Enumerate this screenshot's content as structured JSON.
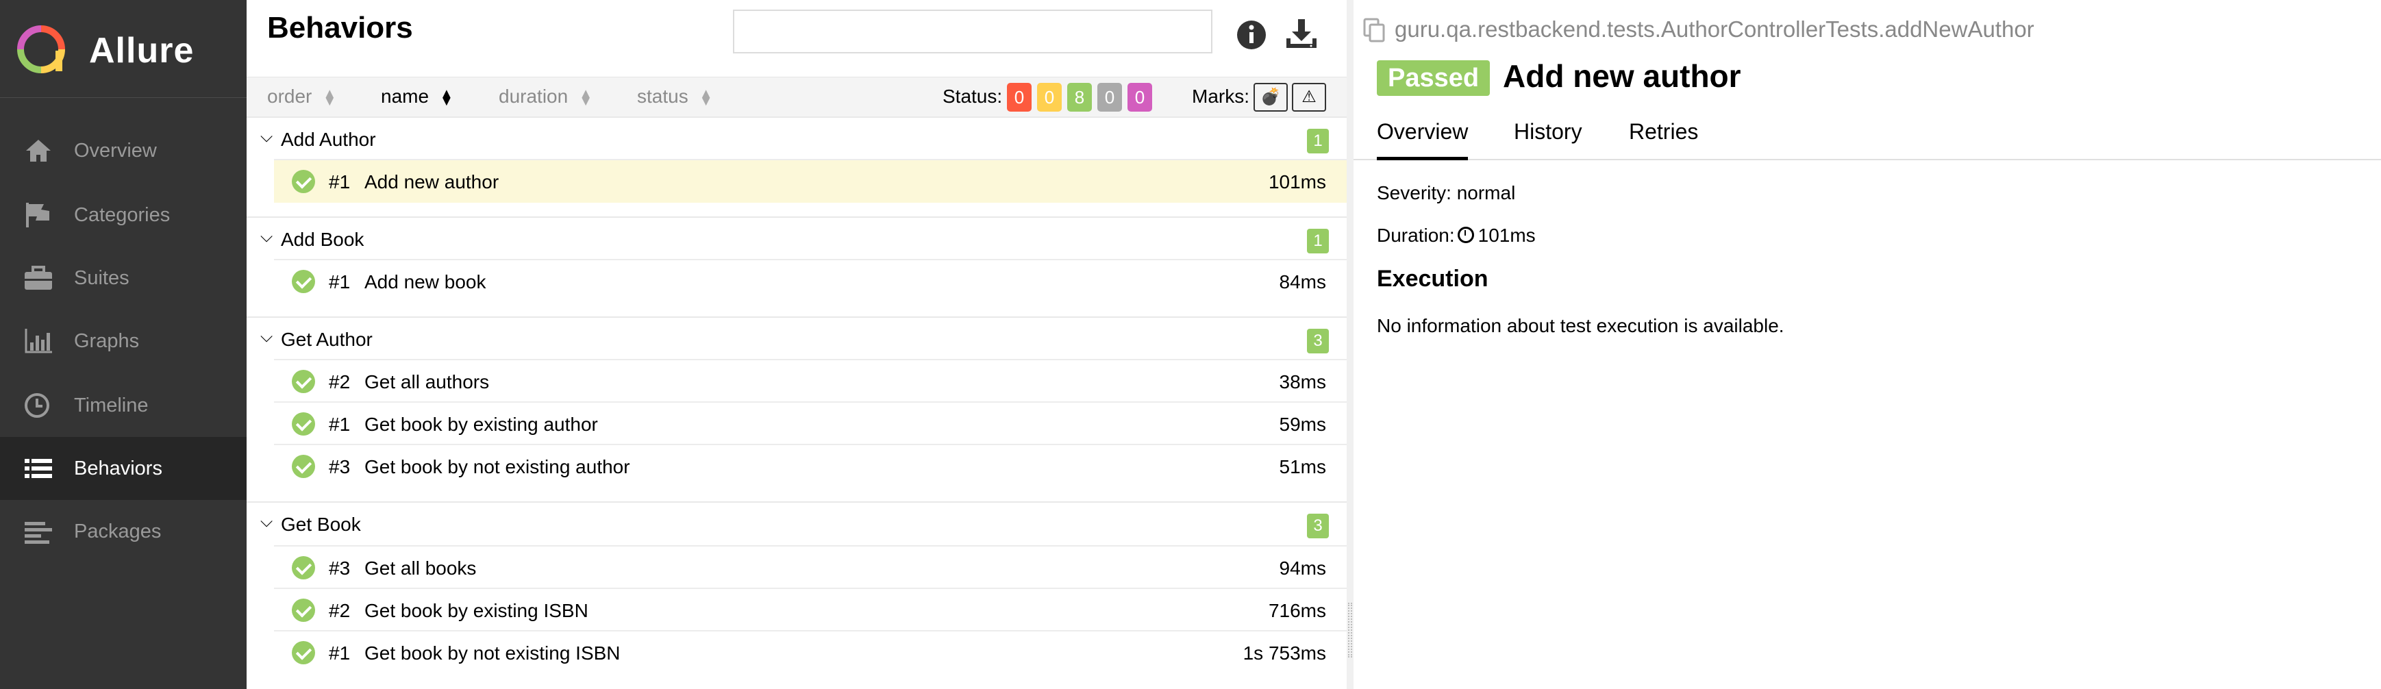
{
  "sidebar": {
    "brand": "Allure",
    "items": [
      {
        "label": "Overview",
        "icon": "home-icon"
      },
      {
        "label": "Categories",
        "icon": "flag-icon"
      },
      {
        "label": "Suites",
        "icon": "briefcase-icon"
      },
      {
        "label": "Graphs",
        "icon": "bar-chart-icon"
      },
      {
        "label": "Timeline",
        "icon": "clock-icon"
      },
      {
        "label": "Behaviors",
        "icon": "list-icon",
        "active": true
      },
      {
        "label": "Packages",
        "icon": "align-left-icon"
      }
    ]
  },
  "main": {
    "title": "Behaviors",
    "search_value": "",
    "sort": {
      "order": "order",
      "name": "name",
      "duration": "duration",
      "status": "status"
    },
    "status_label": "Status:",
    "status_counts": [
      {
        "value": "0",
        "color": "#fd5a3e"
      },
      {
        "value": "0",
        "color": "#ffd050"
      },
      {
        "value": "8",
        "color": "#97cc64"
      },
      {
        "value": "0",
        "color": "#aaaaaa"
      },
      {
        "value": "0",
        "color": "#d35ebe"
      }
    ],
    "marks_label": "Marks:",
    "groups": [
      {
        "name": "Add Author",
        "count": "1",
        "tests": [
          {
            "num": "#1",
            "name": "Add new author",
            "duration": "101ms",
            "selected": true
          }
        ]
      },
      {
        "name": "Add Book",
        "count": "1",
        "tests": [
          {
            "num": "#1",
            "name": "Add new book",
            "duration": "84ms"
          }
        ]
      },
      {
        "name": "Get Author",
        "count": "3",
        "tests": [
          {
            "num": "#2",
            "name": "Get all authors",
            "duration": "38ms"
          },
          {
            "num": "#1",
            "name": "Get book by existing author",
            "duration": "59ms"
          },
          {
            "num": "#3",
            "name": "Get book by not existing author",
            "duration": "51ms"
          }
        ]
      },
      {
        "name": "Get Book",
        "count": "3",
        "tests": [
          {
            "num": "#3",
            "name": "Get all books",
            "duration": "94ms"
          },
          {
            "num": "#2",
            "name": "Get book by existing ISBN",
            "duration": "716ms"
          },
          {
            "num": "#1",
            "name": "Get book by not existing ISBN",
            "duration": "1s 753ms"
          }
        ]
      }
    ]
  },
  "detail": {
    "full_name": "guru.qa.restbackend.tests.AuthorControllerTests.addNewAuthor",
    "status": "Passed",
    "title": "Add new author",
    "tabs": [
      "Overview",
      "History",
      "Retries"
    ],
    "severity": "Severity: normal",
    "duration_label": "Duration:",
    "duration": "101ms",
    "execution_heading": "Execution",
    "execution_text": "No information about test execution is available."
  },
  "colors": {
    "passed": "#97cc64",
    "sidebar": "#343434",
    "selected_row": "#fcf8d9",
    "active_accent": "#6fa8dc"
  }
}
